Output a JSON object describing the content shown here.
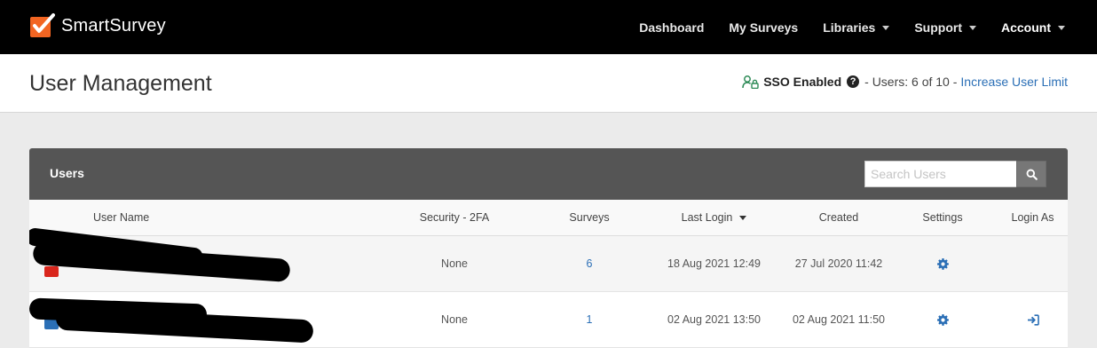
{
  "app": {
    "name": "SmartSurvey",
    "brand_color": "#f26522",
    "link_color": "#2b6fb6"
  },
  "nav": {
    "items": [
      {
        "label": "Dashboard",
        "has_caret": false
      },
      {
        "label": "My Surveys",
        "has_caret": false
      },
      {
        "label": "Libraries",
        "has_caret": true
      },
      {
        "label": "Support",
        "has_caret": true
      },
      {
        "label": "Account",
        "has_caret": true
      }
    ]
  },
  "header": {
    "title": "User Management",
    "sso_label": "SSO Enabled",
    "users_text": "- Users: 6 of 10 -",
    "increase_link": "Increase User Limit",
    "help_glyph": "?"
  },
  "panel": {
    "title": "Users",
    "search_placeholder": "Search Users"
  },
  "table": {
    "columns": {
      "user_name": "User Name",
      "security": "Security - 2FA",
      "surveys": "Surveys",
      "last_login": "Last Login",
      "created": "Created",
      "settings": "Settings",
      "login_as": "Login As"
    },
    "rows": [
      {
        "security": "None",
        "surveys": "6",
        "last_login": "18 Aug 2021 12:49",
        "created": "27 Jul 2020 11:42",
        "has_login_as": false,
        "avatar_color": "#d9261c"
      },
      {
        "security": "None",
        "surveys": "1",
        "last_login": "02 Aug 2021 13:50",
        "created": "02 Aug 2021 11:50",
        "has_login_as": true,
        "avatar_color": "#2b6fb6"
      }
    ]
  }
}
